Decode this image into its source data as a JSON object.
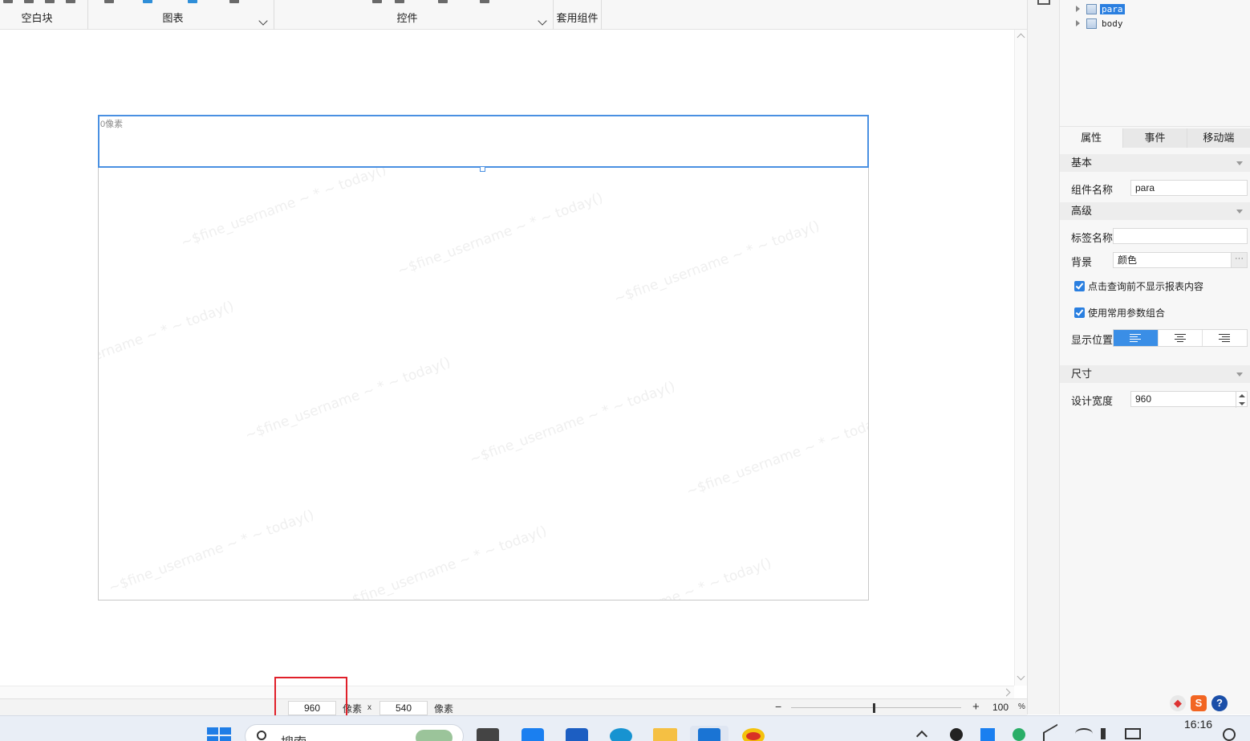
{
  "toolbar": {
    "groups": [
      {
        "label": "空白块"
      },
      {
        "label": "图表"
      },
      {
        "label": "控件"
      },
      {
        "label": "套用组件"
      }
    ]
  },
  "canvas": {
    "para_height_label": "0像素",
    "watermark_text": "~$fine_username ~ * ~ today()"
  },
  "statusbar": {
    "width_value": "960",
    "width_unit": "像素",
    "times": "x",
    "height_value": "540",
    "height_unit": "像素",
    "zoom_minus": "−",
    "zoom_plus": "+",
    "zoom_value": "100",
    "zoom_unit": "%"
  },
  "tree": {
    "items": [
      {
        "label": "para",
        "selected": true
      },
      {
        "label": "body",
        "selected": false
      }
    ]
  },
  "panel": {
    "tabs": [
      "属性",
      "事件",
      "移动端"
    ],
    "active_tab": "属性",
    "sections": {
      "basic": "基本",
      "advanced": "高级",
      "size": "尺寸"
    },
    "component_name_label": "组件名称",
    "component_name_value": "para",
    "tag_name_label": "标签名称",
    "tag_name_value": "",
    "background_label": "背景",
    "background_value": "颜色",
    "ellipsis": "···",
    "checkbox1": "点击查询前不显示报表内容",
    "checkbox2": "使用常用参数组合",
    "display_position_label": "显示位置",
    "design_width_label": "设计宽度",
    "design_width_value": "960"
  },
  "taskbar": {
    "search_placeholder": "搜索",
    "time": "16:16"
  },
  "colors": {
    "accent": "#2a7fe0",
    "selection_border": "#4a90e2",
    "highlight": "#e0202a"
  }
}
